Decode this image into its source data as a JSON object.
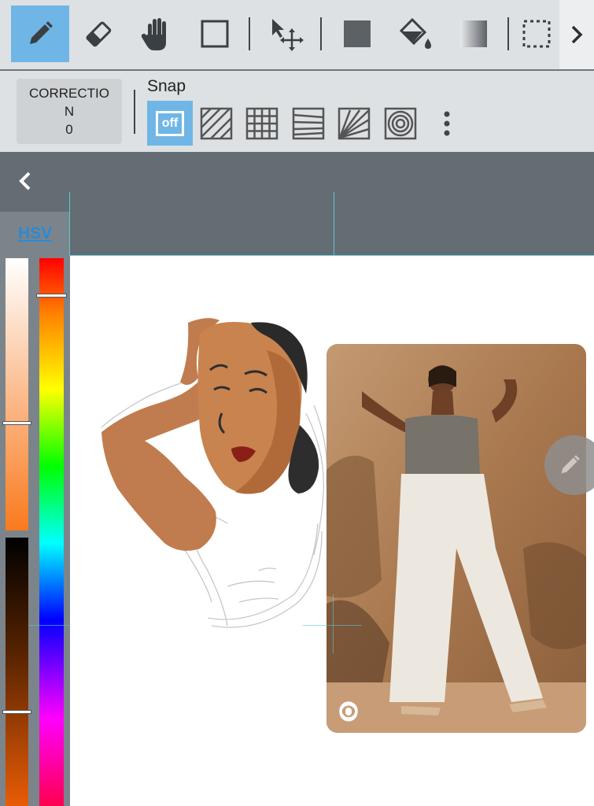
{
  "toolbar": {
    "tools": [
      {
        "name": "pencil-tool",
        "icon": "pencil-icon",
        "active": true
      },
      {
        "name": "eraser-tool",
        "icon": "eraser-icon",
        "active": false
      },
      {
        "name": "hand-tool",
        "icon": "hand-icon",
        "active": false
      },
      {
        "name": "rectangle-tool",
        "icon": "rectangle-icon",
        "active": false
      },
      {
        "name": "move-tool",
        "icon": "move-arrows-icon",
        "active": false
      },
      {
        "name": "fill-color-tool",
        "icon": "filled-square-icon",
        "active": false
      },
      {
        "name": "bucket-tool",
        "icon": "paint-bucket-icon",
        "active": false
      },
      {
        "name": "gradient-tool",
        "icon": "gradient-icon",
        "active": false
      },
      {
        "name": "selection-tool",
        "icon": "dotted-selection-icon",
        "active": false
      }
    ],
    "more_icon": "chevron-right-icon",
    "accent_color": "#6fb6e6"
  },
  "snapbar": {
    "correction_line1": "CORRECTIO",
    "correction_line2": "N",
    "correction_value": "0",
    "snap_label": "Snap",
    "off_label": "off",
    "snap_modes": [
      "off",
      "parallel-lines-icon",
      "grid-icon",
      "perspective-lines-icon",
      "radial-lines-icon",
      "concentric-circles-icon"
    ],
    "more_icon": "vertical-dots-icon"
  },
  "panel": {
    "back_icon": "chevron-left-icon",
    "color_tab": "HSV",
    "tab_color": "#2a8ad6"
  },
  "colors": {
    "current": "#f07418",
    "saturation_level": 0.61,
    "brightness_level": 0.65,
    "hue_level": 0.07
  },
  "canvas": {
    "reference_icon": "target-icon",
    "fab_icon": "pencil-icon"
  }
}
